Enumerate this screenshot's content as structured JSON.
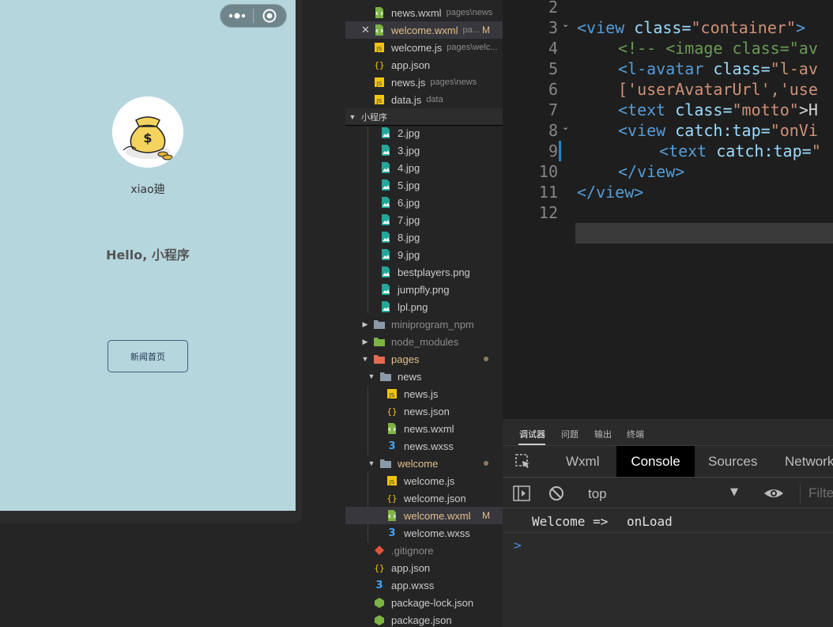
{
  "simulator": {
    "capsule": {
      "menu_icon": "more-dots-icon",
      "close_icon": "target-circle-icon"
    },
    "avatar_icon": "money-bag-avatar",
    "username": "xiao廸",
    "motto": "Hello, 小程序",
    "news_button": "新闻首页",
    "colors": {
      "background": "#b6d6de",
      "button_border": "#405f80"
    }
  },
  "explorer": {
    "open_editors": [
      {
        "name": "news.wxml",
        "desc": "pages\\news"
      },
      {
        "name": "welcome.wxml",
        "desc": "pa...",
        "badge": "M"
      },
      {
        "name": "welcome.js",
        "desc": "pages\\welc..."
      },
      {
        "name": "app.json",
        "desc": ""
      },
      {
        "name": "news.js",
        "desc": "pages\\news"
      },
      {
        "name": "data.js",
        "desc": "data"
      }
    ],
    "project_title": "小程序",
    "image_files": [
      "2.jpg",
      "3.jpg",
      "4.jpg",
      "5.jpg",
      "6.jpg",
      "7.jpg",
      "8.jpg",
      "9.jpg",
      "bestplayers.png",
      "jumpfly.png",
      "lpl.png"
    ],
    "folders": {
      "npm": "miniprogram_npm",
      "node": "node_modules",
      "pages": "pages",
      "news": "news",
      "welcome": "welcome"
    },
    "news_files": [
      "news.js",
      "news.json",
      "news.wxml",
      "news.wxss"
    ],
    "welcome_files": [
      "welcome.js",
      "welcome.json",
      "welcome.wxml",
      "welcome.wxss"
    ],
    "welcome_wxml_badge": "M",
    "root_files": [
      ".gitignore",
      "app.json",
      "app.wxss",
      "package-lock.json",
      "package.json"
    ]
  },
  "editor": {
    "line_numbers": [
      "2",
      "3",
      "4",
      "5",
      "6",
      "7",
      "8",
      "9",
      "10",
      "11",
      "12"
    ],
    "lines": {
      "l3": [
        "<view",
        "class=",
        "\"container\"",
        ">"
      ],
      "l4": "<!-- <image class=\"av",
      "l5a": [
        "<l-avatar",
        "class=",
        "\"l-av"
      ],
      "l5b": "['userAvatarUrl','use",
      "l6": [
        "<text",
        "class=",
        "\"motto\"",
        ">H"
      ],
      "l7": [
        "<view",
        "catch:tap=",
        "\"onVi"
      ],
      "l8": [
        "<text",
        "catch:tap=",
        "\""
      ],
      "l9": "</view>",
      "l10": "</view>"
    }
  },
  "debugger": {
    "tabs": [
      "调试器",
      "问题",
      "输出",
      "终端"
    ],
    "devtools_tabs": [
      "Wxml",
      "Console",
      "Sources",
      "Network"
    ],
    "context": "top",
    "filter_placeholder": "Filte",
    "log": {
      "left": "Welcome =>",
      "right": "onLoad"
    },
    "prompt": ">"
  }
}
